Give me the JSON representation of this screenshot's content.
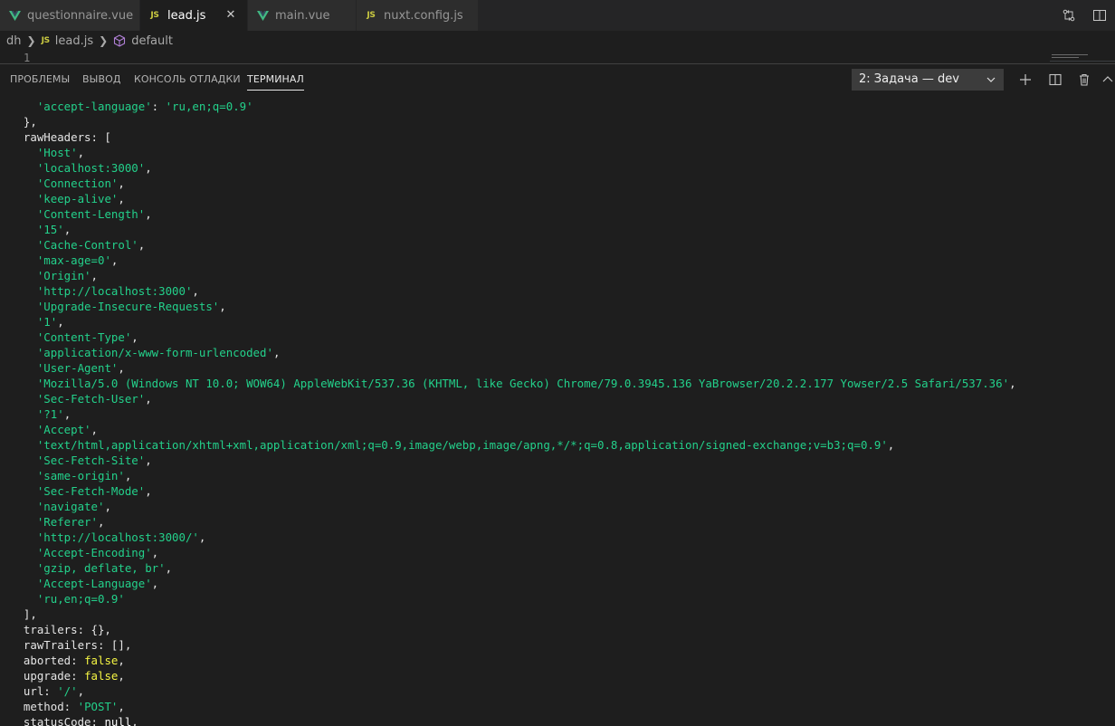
{
  "tabs": [
    {
      "label": "questionnaire.vue",
      "icon": "vue-icon",
      "active": false
    },
    {
      "label": "lead.js",
      "icon": "js-icon",
      "active": true
    },
    {
      "label": "main.vue",
      "icon": "vue-icon",
      "active": false
    },
    {
      "label": "nuxt.config.js",
      "icon": "js-icon",
      "active": false
    }
  ],
  "icons": {
    "js": "JS",
    "close": "✕",
    "chevron_right": "❯",
    "plus": "+",
    "chevron_up": "⌃"
  },
  "breadcrumb": {
    "folder": "dh",
    "file": "lead.js",
    "symbol": "default"
  },
  "editor": {
    "line_number": "1"
  },
  "panel": {
    "tabs": [
      "ПРОБЛЕМЫ",
      "ВЫВОД",
      "КОНСОЛЬ ОТЛАДКИ",
      "ТЕРМИНАЛ"
    ],
    "active_tab": "ТЕРМИНАЛ",
    "task_select": "2: Задача — dev"
  },
  "colors": {
    "string": "#23d18b",
    "keyword": "#f5f543",
    "text": "#cccccc",
    "background": "#1e1e1e"
  },
  "terminal": {
    "lines": [
      [
        {
          "t": "    "
        },
        {
          "s": "'accept-language'"
        },
        {
          "t": ": "
        },
        {
          "s": "'ru,en;q=0.9'"
        }
      ],
      [
        {
          "t": "  },"
        }
      ],
      [
        {
          "t": "  rawHeaders: ["
        }
      ],
      [
        {
          "t": "    "
        },
        {
          "s": "'Host'"
        },
        {
          "t": ","
        }
      ],
      [
        {
          "t": "    "
        },
        {
          "s": "'localhost:3000'"
        },
        {
          "t": ","
        }
      ],
      [
        {
          "t": "    "
        },
        {
          "s": "'Connection'"
        },
        {
          "t": ","
        }
      ],
      [
        {
          "t": "    "
        },
        {
          "s": "'keep-alive'"
        },
        {
          "t": ","
        }
      ],
      [
        {
          "t": "    "
        },
        {
          "s": "'Content-Length'"
        },
        {
          "t": ","
        }
      ],
      [
        {
          "t": "    "
        },
        {
          "s": "'15'"
        },
        {
          "t": ","
        }
      ],
      [
        {
          "t": "    "
        },
        {
          "s": "'Cache-Control'"
        },
        {
          "t": ","
        }
      ],
      [
        {
          "t": "    "
        },
        {
          "s": "'max-age=0'"
        },
        {
          "t": ","
        }
      ],
      [
        {
          "t": "    "
        },
        {
          "s": "'Origin'"
        },
        {
          "t": ","
        }
      ],
      [
        {
          "t": "    "
        },
        {
          "s": "'http://localhost:3000'"
        },
        {
          "t": ","
        }
      ],
      [
        {
          "t": "    "
        },
        {
          "s": "'Upgrade-Insecure-Requests'"
        },
        {
          "t": ","
        }
      ],
      [
        {
          "t": "    "
        },
        {
          "s": "'1'"
        },
        {
          "t": ","
        }
      ],
      [
        {
          "t": "    "
        },
        {
          "s": "'Content-Type'"
        },
        {
          "t": ","
        }
      ],
      [
        {
          "t": "    "
        },
        {
          "s": "'application/x-www-form-urlencoded'"
        },
        {
          "t": ","
        }
      ],
      [
        {
          "t": "    "
        },
        {
          "s": "'User-Agent'"
        },
        {
          "t": ","
        }
      ],
      [
        {
          "t": "    "
        },
        {
          "s": "'Mozilla/5.0 (Windows NT 10.0; WOW64) AppleWebKit/537.36 (KHTML, like Gecko) Chrome/79.0.3945.136 YaBrowser/20.2.2.177 Yowser/2.5 Safari/537.36'"
        },
        {
          "t": ","
        }
      ],
      [
        {
          "t": "    "
        },
        {
          "s": "'Sec-Fetch-User'"
        },
        {
          "t": ","
        }
      ],
      [
        {
          "t": "    "
        },
        {
          "s": "'?1'"
        },
        {
          "t": ","
        }
      ],
      [
        {
          "t": "    "
        },
        {
          "s": "'Accept'"
        },
        {
          "t": ","
        }
      ],
      [
        {
          "t": "    "
        },
        {
          "s": "'text/html,application/xhtml+xml,application/xml;q=0.9,image/webp,image/apng,*/*;q=0.8,application/signed-exchange;v=b3;q=0.9'"
        },
        {
          "t": ","
        }
      ],
      [
        {
          "t": "    "
        },
        {
          "s": "'Sec-Fetch-Site'"
        },
        {
          "t": ","
        }
      ],
      [
        {
          "t": "    "
        },
        {
          "s": "'same-origin'"
        },
        {
          "t": ","
        }
      ],
      [
        {
          "t": "    "
        },
        {
          "s": "'Sec-Fetch-Mode'"
        },
        {
          "t": ","
        }
      ],
      [
        {
          "t": "    "
        },
        {
          "s": "'navigate'"
        },
        {
          "t": ","
        }
      ],
      [
        {
          "t": "    "
        },
        {
          "s": "'Referer'"
        },
        {
          "t": ","
        }
      ],
      [
        {
          "t": "    "
        },
        {
          "s": "'http://localhost:3000/'"
        },
        {
          "t": ","
        }
      ],
      [
        {
          "t": "    "
        },
        {
          "s": "'Accept-Encoding'"
        },
        {
          "t": ","
        }
      ],
      [
        {
          "t": "    "
        },
        {
          "s": "'gzip, deflate, br'"
        },
        {
          "t": ","
        }
      ],
      [
        {
          "t": "    "
        },
        {
          "s": "'Accept-Language'"
        },
        {
          "t": ","
        }
      ],
      [
        {
          "t": "    "
        },
        {
          "s": "'ru,en;q=0.9'"
        }
      ],
      [
        {
          "t": "  ],"
        }
      ],
      [
        {
          "t": "  trailers: {},"
        }
      ],
      [
        {
          "t": "  rawTrailers: [],"
        }
      ],
      [
        {
          "t": "  aborted: "
        },
        {
          "k": "false"
        },
        {
          "t": ","
        }
      ],
      [
        {
          "t": "  upgrade: "
        },
        {
          "k": "false"
        },
        {
          "t": ","
        }
      ],
      [
        {
          "t": "  url: "
        },
        {
          "s": "'/'"
        },
        {
          "t": ","
        }
      ],
      [
        {
          "t": "  method: "
        },
        {
          "s": "'POST'"
        },
        {
          "t": ","
        }
      ],
      [
        {
          "t": "  statusCode: "
        },
        {
          "t": "null",
          "b": true
        },
        {
          "t": ","
        }
      ]
    ]
  }
}
